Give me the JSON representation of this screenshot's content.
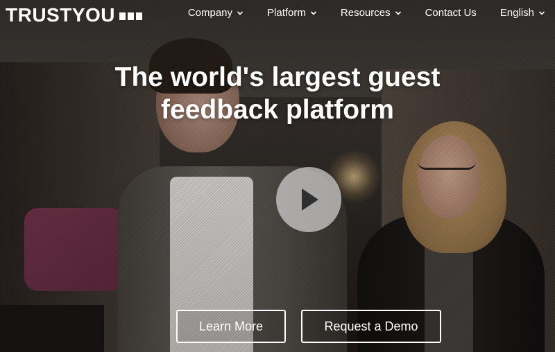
{
  "brand": {
    "name": "TRUSTYOU",
    "logo_block_count": 3
  },
  "nav": {
    "items": [
      {
        "label": "Company",
        "has_dropdown": true
      },
      {
        "label": "Platform",
        "has_dropdown": true
      },
      {
        "label": "Resources",
        "has_dropdown": true
      },
      {
        "label": "Contact Us",
        "has_dropdown": false
      },
      {
        "label": "English",
        "has_dropdown": true
      }
    ]
  },
  "hero": {
    "headline_line1": "The world's largest guest",
    "headline_line2": "feedback platform",
    "play_icon": "play-icon",
    "buttons": {
      "learn_more": "Learn More",
      "request_demo": "Request a Demo"
    }
  },
  "colors": {
    "text": "#ffffff",
    "play_button_bg": "#d2d2d2",
    "play_icon": "#2f2f2f"
  }
}
